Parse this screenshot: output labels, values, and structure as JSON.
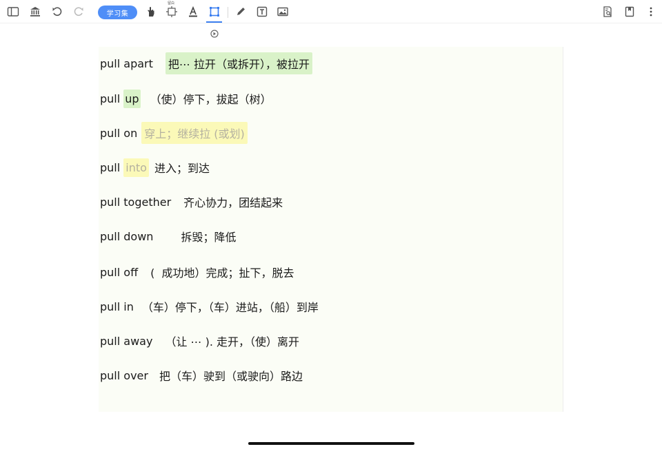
{
  "toolbar": {
    "study_set_label": "学习集",
    "mini_label": "留白"
  },
  "icons": {
    "left": [
      "sidebar-icon",
      "library-icon",
      "undo-icon",
      "redo-icon"
    ],
    "tools": [
      "hand-icon",
      "resize-icon",
      "text-color-icon",
      "crop-icon",
      "pen-icon",
      "textbox-icon",
      "image-icon"
    ],
    "right": [
      "document-search-icon",
      "bookmark-icon",
      "more-icon"
    ]
  },
  "colors": {
    "accent": "#4f8ef7",
    "highlight_green": "#d9f2c8",
    "highlight_yellow": "#fbf9b8"
  },
  "entries": [
    {
      "phrase": "pull apart",
      "meaning": "把⋯ 拉开（或拆开），被拉开"
    },
    {
      "phrase_a": "pull ",
      "phrase_b": "up",
      "meaning": "（使）停下，拔起（树）"
    },
    {
      "phrase": "pull on",
      "meaning": "穿上；继续拉 (或划)"
    },
    {
      "phrase_a": "pull ",
      "phrase_b": "into",
      "meaning": "进入；到达"
    },
    {
      "phrase": "pull together",
      "meaning": "齐心协力，团结起来"
    },
    {
      "phrase": "pull down",
      "meaning": "拆毁；降低"
    },
    {
      "phrase": "pull off",
      "meaning": "(  成功地）完成；扯下，脱去"
    },
    {
      "phrase": "pull in",
      "meaning": "（车）停下，（车）进站，（船）到岸"
    },
    {
      "phrase": "pull away",
      "meaning": "（让 ⋯ ). 走开，（使）离开"
    },
    {
      "phrase": "pull over",
      "meaning": "把（车）驶到（或驶向）路边"
    }
  ]
}
